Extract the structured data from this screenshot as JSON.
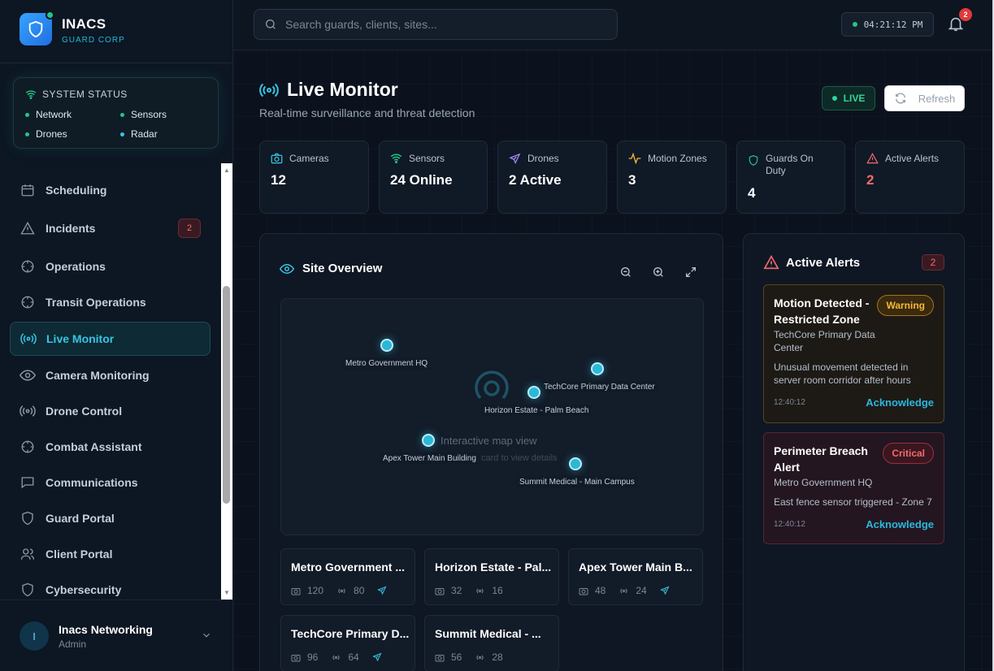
{
  "brand": {
    "name": "INACS",
    "sub": "GUARD CORP"
  },
  "system_status": {
    "title": "SYSTEM STATUS",
    "items": [
      {
        "label": "Network",
        "color": "#22c58b"
      },
      {
        "label": "Sensors",
        "color": "#22c58b"
      },
      {
        "label": "Drones",
        "color": "#22c58b"
      },
      {
        "label": "Radar",
        "color": "#36c6e3"
      }
    ]
  },
  "sidebar": {
    "items": [
      {
        "label": "Scheduling",
        "icon": "calendar-icon"
      },
      {
        "label": "Incidents",
        "icon": "warning-icon",
        "badge": "2"
      },
      {
        "label": "Operations",
        "icon": "crosshair-icon"
      },
      {
        "label": "Transit Operations",
        "icon": "crosshair-icon"
      },
      {
        "label": "Live Monitor",
        "icon": "broadcast-icon",
        "active": true
      },
      {
        "label": "Camera Monitoring",
        "icon": "eye-icon"
      },
      {
        "label": "Drone Control",
        "icon": "broadcast-icon"
      },
      {
        "label": "Combat Assistant",
        "icon": "crosshair-icon"
      },
      {
        "label": "Communications",
        "icon": "chat-icon"
      },
      {
        "label": "Guard Portal",
        "icon": "shield-icon"
      },
      {
        "label": "Client Portal",
        "icon": "users-icon"
      },
      {
        "label": "Cybersecurity",
        "icon": "shield-icon"
      }
    ]
  },
  "user": {
    "initial": "I",
    "name": "Inacs Networking",
    "role": "Admin"
  },
  "topbar": {
    "search_placeholder": "Search guards, clients, sites...",
    "clock": "04:21:12 PM",
    "notifications": "2"
  },
  "page": {
    "title": "Live Monitor",
    "subtitle": "Real-time surveillance and threat detection",
    "live_label": "LIVE",
    "refresh_label": "Refresh"
  },
  "stats": [
    {
      "label": "Cameras",
      "value": "12",
      "icon": "camera-icon"
    },
    {
      "label": "Sensors",
      "value": "24 Online",
      "icon": "wifi-icon"
    },
    {
      "label": "Drones",
      "value": "2 Active",
      "icon": "plane-icon"
    },
    {
      "label": "Motion Zones",
      "value": "3",
      "icon": "pulse-icon"
    },
    {
      "label": "Guards On Duty",
      "value": "4",
      "icon": "shield-icon"
    },
    {
      "label": "Active Alerts",
      "value": "2",
      "icon": "warning-icon"
    }
  ],
  "site_overview": {
    "title": "Site Overview",
    "map_hint": "Interactive map view",
    "map_hint2": "card to view details",
    "pins": [
      {
        "label": "Metro Government HQ"
      },
      {
        "label": "TechCore Primary Data Center"
      },
      {
        "label": "Horizon Estate - Palm Beach"
      },
      {
        "label": "Apex Tower Main Building"
      },
      {
        "label": "Summit Medical - Main Campus"
      }
    ],
    "sites": [
      {
        "name": "Metro Government ...",
        "cameras": "120",
        "sensors": "80",
        "drone": true
      },
      {
        "name": "Horizon Estate - Pal...",
        "cameras": "32",
        "sensors": "16",
        "drone": false
      },
      {
        "name": "Apex Tower Main B...",
        "cameras": "48",
        "sensors": "24",
        "drone": true
      },
      {
        "name": "TechCore Primary D...",
        "cameras": "96",
        "sensors": "64",
        "drone": true
      },
      {
        "name": "Summit Medical - ...",
        "cameras": "56",
        "sensors": "28",
        "drone": false
      }
    ]
  },
  "alerts": {
    "title": "Active Alerts",
    "count": "2",
    "items": [
      {
        "title": "Motion Detected - Restricted Zone",
        "severity": "Warning",
        "site": "TechCore Primary Data Center",
        "desc": "Unusual movement detected in server room corridor after hours",
        "time": "12:40:12",
        "action": "Acknowledge"
      },
      {
        "title": "Perimeter Breach Alert",
        "severity": "Critical",
        "site": "Metro Government HQ",
        "desc": "East fence sensor triggered - Zone 7",
        "time": "12:40:12",
        "action": "Acknowledge"
      }
    ]
  }
}
